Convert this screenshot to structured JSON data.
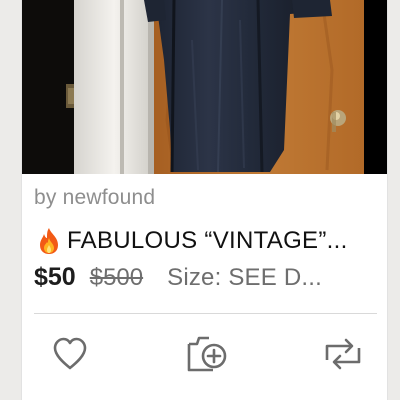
{
  "listing": {
    "seller_label": "by newfound",
    "title": "FABULOUS “VINTAGE”...",
    "price": "$50",
    "original_price": "$500",
    "size_label": "Size: SEE D...",
    "title_icon": "fire-emoji"
  },
  "actions": {
    "like_icon": "heart-icon",
    "bundle_icon": "add-to-bundle-icon",
    "share_icon": "repost-icon"
  },
  "colors": {
    "icon": "#6c6c6c",
    "text_muted": "#8e8e8e",
    "text_main": "#111111"
  }
}
